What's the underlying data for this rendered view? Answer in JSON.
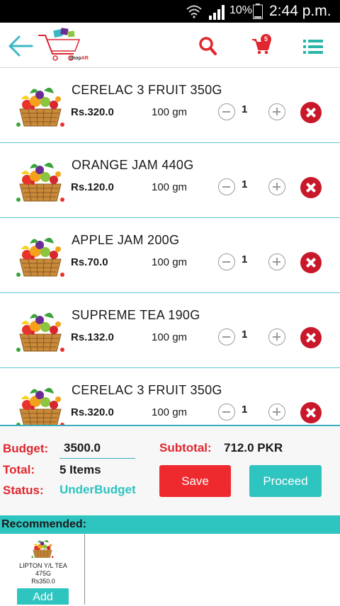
{
  "status_bar": {
    "battery_percent": "10%",
    "time": "2:44 p.m."
  },
  "header": {
    "logo_text_prefix": "shop",
    "logo_text_suffix": "AR",
    "cart_count": "5",
    "colors": {
      "accent": "#2ec4c0",
      "brand_red": "#e0262e"
    }
  },
  "cart": {
    "items": [
      {
        "name": "CERELAC 3 FRUIT 350G",
        "price": "Rs.320.0",
        "unit": "100 gm",
        "qty": "1"
      },
      {
        "name": "ORANGE JAM 440G",
        "price": "Rs.120.0",
        "unit": "100 gm",
        "qty": "1"
      },
      {
        "name": "APPLE JAM 200G",
        "price": "Rs.70.0",
        "unit": "100 gm",
        "qty": "1"
      },
      {
        "name": "SUPREME TEA 190G",
        "price": "Rs.132.0",
        "unit": "100 gm",
        "qty": "1"
      },
      {
        "name": "CERELAC 3 FRUIT 350G",
        "price": "Rs.320.0",
        "unit": "100 gm",
        "qty": "1"
      }
    ]
  },
  "summary": {
    "budget_label": "Budget:",
    "budget_value": "3500.0",
    "total_label": "Total:",
    "total_value": "5 Items",
    "status_label": "Status:",
    "status_value": "UnderBudget",
    "subtotal_label": "Subtotal:",
    "subtotal_value": "712.0 PKR",
    "save_label": "Save",
    "proceed_label": "Proceed"
  },
  "recommended": {
    "title": "Recommended:",
    "items": [
      {
        "name": "LIPTON Y/L TEA 475G",
        "price": "Rs350.0",
        "add_label": "Add"
      }
    ]
  }
}
